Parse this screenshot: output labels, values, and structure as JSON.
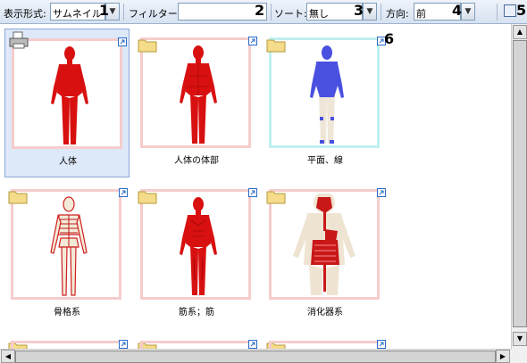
{
  "toolbar": {
    "display_label": "表示形式:",
    "display_value": "サムネイル",
    "filter_label": "フィルター:",
    "filter_value": "",
    "sort_label": "ソート:",
    "sort_value": "無し",
    "direction_label": "方向:",
    "direction_value": "前",
    "markers": [
      "1",
      "2",
      "3",
      "4",
      "5",
      "6"
    ]
  },
  "items": [
    {
      "caption": "人体",
      "selected": true
    },
    {
      "caption": "人体の体部"
    },
    {
      "caption": "平面、線"
    },
    {
      "caption": "骨格系"
    },
    {
      "caption": "筋系；筋"
    },
    {
      "caption": "消化器系"
    }
  ],
  "colors": {
    "selection": "#dde8f8",
    "thumb_border": "#f6cccc",
    "thumb_border_alt": "#bff0f0",
    "body_red": "#d81010",
    "plane_blue": "#4a50e0"
  },
  "icons": {
    "folder": "folder-icon",
    "link": "shortcut-link-icon",
    "panel": "panel-toggle-icon",
    "printer": "print-icon"
  }
}
